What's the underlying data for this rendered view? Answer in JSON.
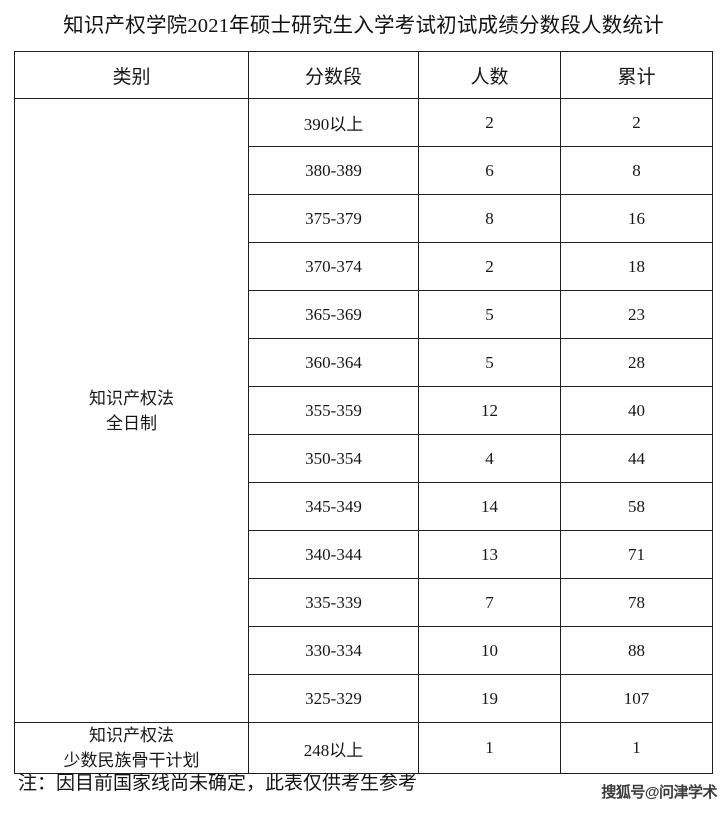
{
  "document": {
    "title": "知识产权学院2021年硕士研究生入学考试初试成绩分数段人数统计",
    "note": "注：因目前国家线尚未确定，此表仅供考生参考",
    "watermark": "搜狐号@问津学术"
  },
  "table": {
    "columns": [
      "类别",
      "分数段",
      "人数",
      "累计"
    ],
    "groups": [
      {
        "category": "知识产权法\n全日制",
        "rows": [
          {
            "band": "390以上",
            "count": "2",
            "cumulative": "2"
          },
          {
            "band": "380-389",
            "count": "6",
            "cumulative": "8"
          },
          {
            "band": "375-379",
            "count": "8",
            "cumulative": "16"
          },
          {
            "band": "370-374",
            "count": "2",
            "cumulative": "18"
          },
          {
            "band": "365-369",
            "count": "5",
            "cumulative": "23"
          },
          {
            "band": "360-364",
            "count": "5",
            "cumulative": "28"
          },
          {
            "band": "355-359",
            "count": "12",
            "cumulative": "40"
          },
          {
            "band": "350-354",
            "count": "4",
            "cumulative": "44"
          },
          {
            "band": "345-349",
            "count": "14",
            "cumulative": "58"
          },
          {
            "band": "340-344",
            "count": "13",
            "cumulative": "71"
          },
          {
            "band": "335-339",
            "count": "7",
            "cumulative": "78"
          },
          {
            "band": "330-334",
            "count": "10",
            "cumulative": "88"
          },
          {
            "band": "325-329",
            "count": "19",
            "cumulative": "107"
          }
        ]
      },
      {
        "category": "知识产权法\n少数民族骨干计划",
        "rows": [
          {
            "band": "248以上",
            "count": "1",
            "cumulative": "1"
          }
        ]
      }
    ]
  },
  "colors": {
    "border": "#1d1d1d",
    "text": "#171717",
    "background": "#ffffff"
  }
}
